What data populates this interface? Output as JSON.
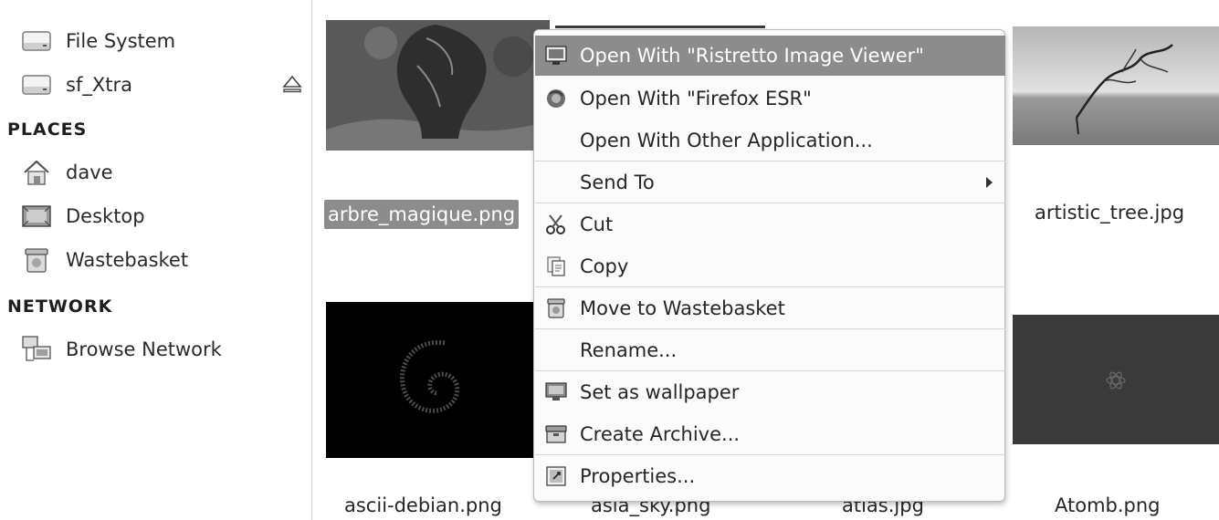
{
  "sidebar": {
    "devices": [
      {
        "label": "File System",
        "icon": "drive-icon"
      },
      {
        "label": "sf_Xtra",
        "icon": "drive-icon"
      }
    ],
    "places_header": "PLACES",
    "places": [
      {
        "label": "dave",
        "icon": "home-icon"
      },
      {
        "label": "Desktop",
        "icon": "desktop-icon"
      },
      {
        "label": "Wastebasket",
        "icon": "trash-icon"
      }
    ],
    "network_header": "NETWORK",
    "network": [
      {
        "label": "Browse Network",
        "icon": "network-icon"
      }
    ]
  },
  "files": [
    {
      "name": "arbre_magique.png",
      "selected": true
    },
    {
      "name": "artistic_tree.jpg"
    },
    {
      "name": "ascii-debian.png"
    },
    {
      "name": "asia_sky.png"
    },
    {
      "name": "atlas.jpg"
    },
    {
      "name": "Atomb.png"
    }
  ],
  "context_menu": {
    "items": [
      {
        "label": "Open With \"Ristretto Image Viewer\"",
        "icon": "image-viewer-icon",
        "active": true
      },
      {
        "label": "Open With \"Firefox ESR\"",
        "icon": "firefox-icon"
      },
      {
        "label": "Open With Other Application...",
        "icon": ""
      },
      {
        "label": "Send To",
        "icon": "",
        "submenu": true
      },
      {
        "label": "Cut",
        "icon": "scissors-icon"
      },
      {
        "label": "Copy",
        "icon": "copy-icon"
      },
      {
        "label": "Move to Wastebasket",
        "icon": "trash-icon"
      },
      {
        "label": "Rename...",
        "icon": ""
      },
      {
        "label": "Set as wallpaper",
        "icon": "wallpaper-icon"
      },
      {
        "label": "Create Archive...",
        "icon": "archive-icon"
      },
      {
        "label": "Properties...",
        "icon": "properties-icon"
      }
    ]
  },
  "colors": {
    "selection": "#8c8c8c",
    "menu_bg": "#fbfbfb",
    "separator": "#d6d6d6"
  }
}
